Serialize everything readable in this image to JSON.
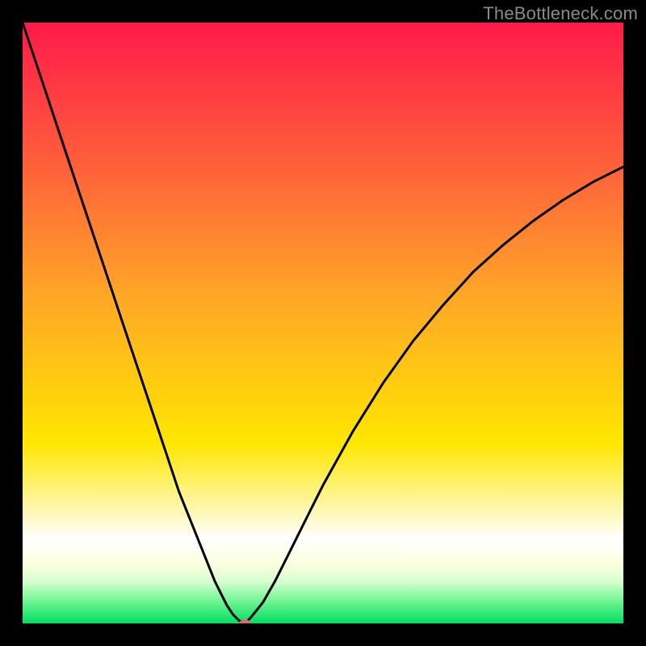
{
  "watermark": "TheBottleneck.com",
  "chart_data": {
    "type": "line",
    "title": "",
    "xlabel": "",
    "ylabel": "",
    "xlim": [
      0,
      100
    ],
    "ylim": [
      0,
      100
    ],
    "grid": false,
    "legend": false,
    "background_gradient": {
      "top": "#ff1a4b",
      "mid": "#ffe600",
      "bottom_band": "#ffffff",
      "bottom": "#00e060"
    },
    "series": [
      {
        "name": "bottleneck-curve",
        "color": "#000000",
        "x": [
          0,
          2,
          4,
          6,
          8,
          10,
          12,
          14,
          16,
          18,
          20,
          22,
          24,
          26,
          28,
          30,
          32,
          33,
          34,
          35,
          36,
          37,
          38,
          40,
          42,
          44,
          46,
          48,
          50,
          55,
          60,
          65,
          70,
          75,
          80,
          85,
          90,
          95,
          100
        ],
        "y": [
          100,
          94,
          88,
          82,
          76,
          70,
          64,
          58,
          52,
          46,
          40,
          34,
          28,
          22,
          17,
          12,
          7,
          5,
          3,
          1.5,
          0.5,
          0,
          1,
          3.5,
          7,
          11,
          15,
          19,
          23,
          32,
          40,
          47,
          53,
          58.5,
          63,
          67,
          70.5,
          73.5,
          76
        ]
      }
    ],
    "markers": [
      {
        "name": "minimum-marker",
        "x": 37,
        "y": 0,
        "color": "#d96a6a",
        "rx": 7,
        "ry": 5
      }
    ]
  }
}
